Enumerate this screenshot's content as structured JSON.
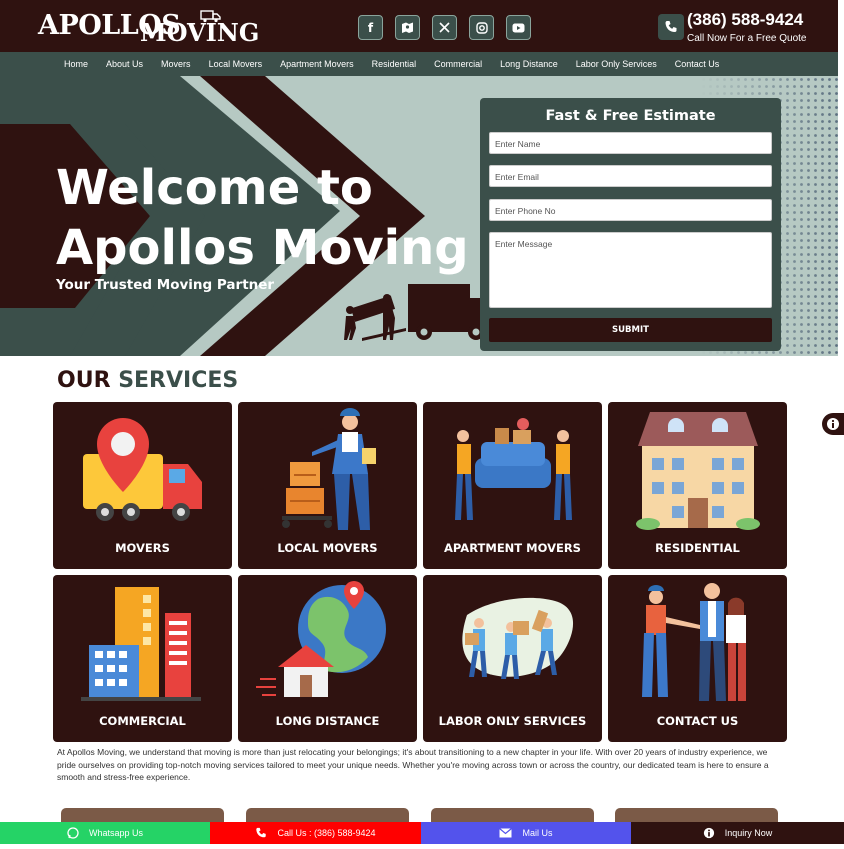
{
  "header": {
    "logo_text_1": "APOLLOS",
    "logo_text_2": "MOVING",
    "socials": [
      "facebook-icon",
      "google-maps-icon",
      "x-icon",
      "instagram-icon",
      "youtube-icon"
    ],
    "phone": "(386) 588-9424",
    "phone_sub": "Call Now For a Free Quote"
  },
  "nav": [
    "Home",
    "About Us",
    "Movers",
    "Local Movers",
    "Apartment Movers",
    "Residential",
    "Commercial",
    "Long Distance",
    "Labor Only Services",
    "Contact Us"
  ],
  "hero": {
    "title": "Welcome to Apollos Moving",
    "subtitle": "Your Trusted Moving Partner"
  },
  "estimate": {
    "title": "Fast & Free Estimate",
    "name_placeholder": "Enter Name",
    "email_placeholder": "Enter Email",
    "phone_placeholder": "Enter Phone No",
    "message_placeholder": "Enter Message",
    "submit": "SUBMIT"
  },
  "services": {
    "heading_our": "OUR",
    "heading_services": "SERVICES",
    "cards": [
      "MOVERS",
      "LOCAL MOVERS",
      "APARTMENT MOVERS",
      "RESIDENTIAL",
      "COMMERCIAL",
      "LONG DISTANCE",
      "LABOR ONLY SERVICES",
      "CONTACT US"
    ]
  },
  "about_text": "At Apollos Moving, we understand that moving is more than just relocating your belongings; it's about transitioning to a new chapter in your life. With over 20 years of industry experience, we pride ourselves on providing top-notch moving services tailored to meet your unique needs. Whether you're moving across town or across the country, our dedicated team is here to ensure a smooth and stress-free experience.",
  "bottom_bar": {
    "whatsapp": "Whatsapp Us",
    "call": "Call Us : (386) 588-9424",
    "mail": "Mail Us",
    "inquiry": "Inquiry Now"
  },
  "colors": {
    "brand_dark": "#2f1210",
    "brand_green": "#3b4f4a",
    "hero_bg": "#b6c9c3",
    "whatsapp": "#25d366",
    "call": "#ff0000",
    "mail": "#5353ec"
  }
}
